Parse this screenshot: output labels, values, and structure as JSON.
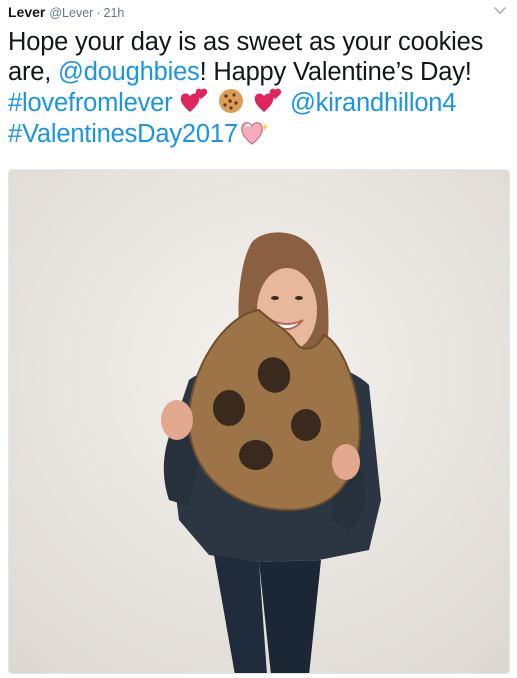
{
  "tweet": {
    "author_name": "Lever",
    "author_handle": "@Lever",
    "separator": "·",
    "time": "21h",
    "text_segments": {
      "t1": "Hope your day is as sweet as your cookies are, ",
      "mention_doughbies": "@doughbies",
      "t2": "! Happy Valentine’s Day! ",
      "hashtag_lovefromlever": "#lovefromlever",
      "mention_kirandhillon4": "@kirandhillon4",
      "hashtag_valentinesday": "#ValentinesDay2017"
    },
    "emojis": [
      "two-hearts-icon",
      "cookie-icon",
      "two-hearts-icon",
      "sparkling-heart-icon"
    ],
    "link_color": "#1b95e0"
  },
  "media": {
    "type": "photo",
    "subject": "person holding a giant cardboard cookie"
  }
}
